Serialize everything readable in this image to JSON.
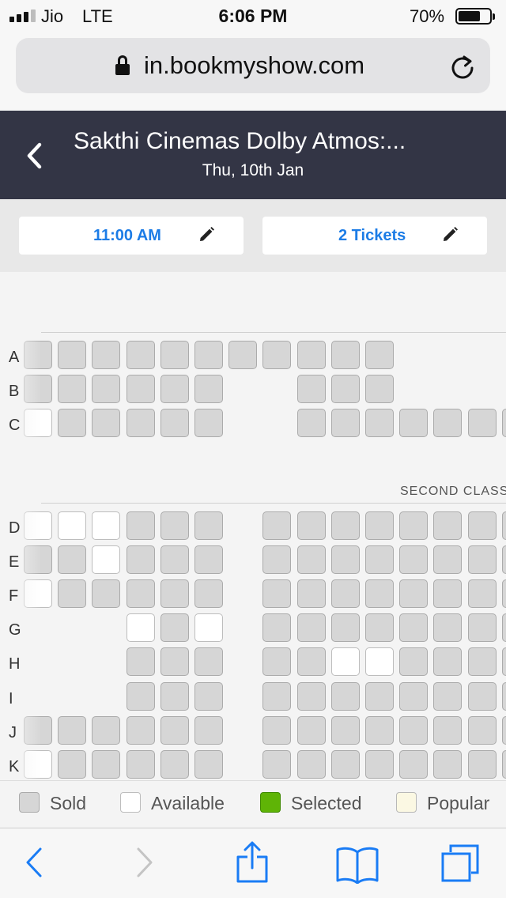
{
  "status_bar": {
    "carrier": "Jio",
    "network": "LTE",
    "time": "6:06 PM",
    "battery_percent": "70%",
    "battery_level": 0.7,
    "signal_bars": 3
  },
  "browser": {
    "url": "in.bookmyshow.com",
    "icons": {
      "lock": "lock-icon",
      "reload": "reload-icon"
    }
  },
  "header": {
    "title": "Sakthi Cinemas Dolby Atmos:...",
    "date": "Thu, 10th Jan",
    "back_icon": "chevron-left-icon"
  },
  "selectors": {
    "showtime": "11:00 AM",
    "tickets": "2 Tickets",
    "edit_icon": "pencil-icon"
  },
  "seat_map": {
    "section_label": "SECOND CLASS",
    "rows": [
      {
        "label": "A",
        "seats": [
          "S",
          "S",
          "S",
          "S",
          "S",
          "S",
          "S",
          "S",
          "S",
          "S",
          "S",
          null,
          null,
          null,
          null
        ]
      },
      {
        "label": "B",
        "seats": [
          "S",
          "S",
          "S",
          "S",
          "S",
          "S",
          null,
          null,
          "S",
          "S",
          "S",
          null,
          null,
          null,
          null
        ]
      },
      {
        "label": "C",
        "seats": [
          "A",
          "S",
          "S",
          "S",
          "S",
          "S",
          null,
          null,
          "S",
          "S",
          "S",
          "S",
          "S",
          "S",
          "S"
        ]
      },
      {
        "label": "D",
        "seats": [
          "A",
          "A",
          "A",
          "S",
          "S",
          "S",
          null,
          "S",
          "S",
          "S",
          "S",
          "S",
          "S",
          "S",
          "S"
        ]
      },
      {
        "label": "E",
        "seats": [
          "S",
          "S",
          "A",
          "S",
          "S",
          "S",
          null,
          "S",
          "S",
          "S",
          "S",
          "S",
          "S",
          "S",
          "S"
        ]
      },
      {
        "label": "F",
        "seats": [
          "A",
          "S",
          "S",
          "S",
          "S",
          "S",
          null,
          "S",
          "S",
          "S",
          "S",
          "S",
          "S",
          "S",
          "S"
        ]
      },
      {
        "label": "G",
        "seats": [
          null,
          null,
          null,
          "A",
          "S",
          "A",
          null,
          "S",
          "S",
          "S",
          "S",
          "S",
          "S",
          "S",
          "S"
        ]
      },
      {
        "label": "H",
        "seats": [
          null,
          null,
          null,
          "S",
          "S",
          "S",
          null,
          "S",
          "S",
          "A",
          "A",
          "S",
          "S",
          "S",
          "S"
        ]
      },
      {
        "label": "I",
        "seats": [
          null,
          null,
          null,
          "S",
          "S",
          "S",
          null,
          "S",
          "S",
          "S",
          "S",
          "S",
          "S",
          "S",
          "S"
        ]
      },
      {
        "label": "J",
        "seats": [
          "S",
          "S",
          "S",
          "S",
          "S",
          "S",
          null,
          "S",
          "S",
          "S",
          "S",
          "S",
          "S",
          "S",
          "S"
        ]
      },
      {
        "label": "K",
        "seats": [
          "A",
          "S",
          "S",
          "S",
          "S",
          "S",
          null,
          "S",
          "S",
          "S",
          "S",
          "S",
          "S",
          "S",
          "S"
        ]
      }
    ]
  },
  "legend": [
    {
      "label": "Sold",
      "color": "#d6d6d6"
    },
    {
      "label": "Available",
      "color": "#ffffff"
    },
    {
      "label": "Selected",
      "color": "#5fb406"
    },
    {
      "label": "Popular",
      "color": "#fbf8e3"
    }
  ],
  "toolbar": {
    "icons": [
      "back-icon",
      "forward-icon",
      "share-icon",
      "bookmarks-icon",
      "tabs-icon"
    ],
    "accent_color": "#1a7cf5"
  }
}
